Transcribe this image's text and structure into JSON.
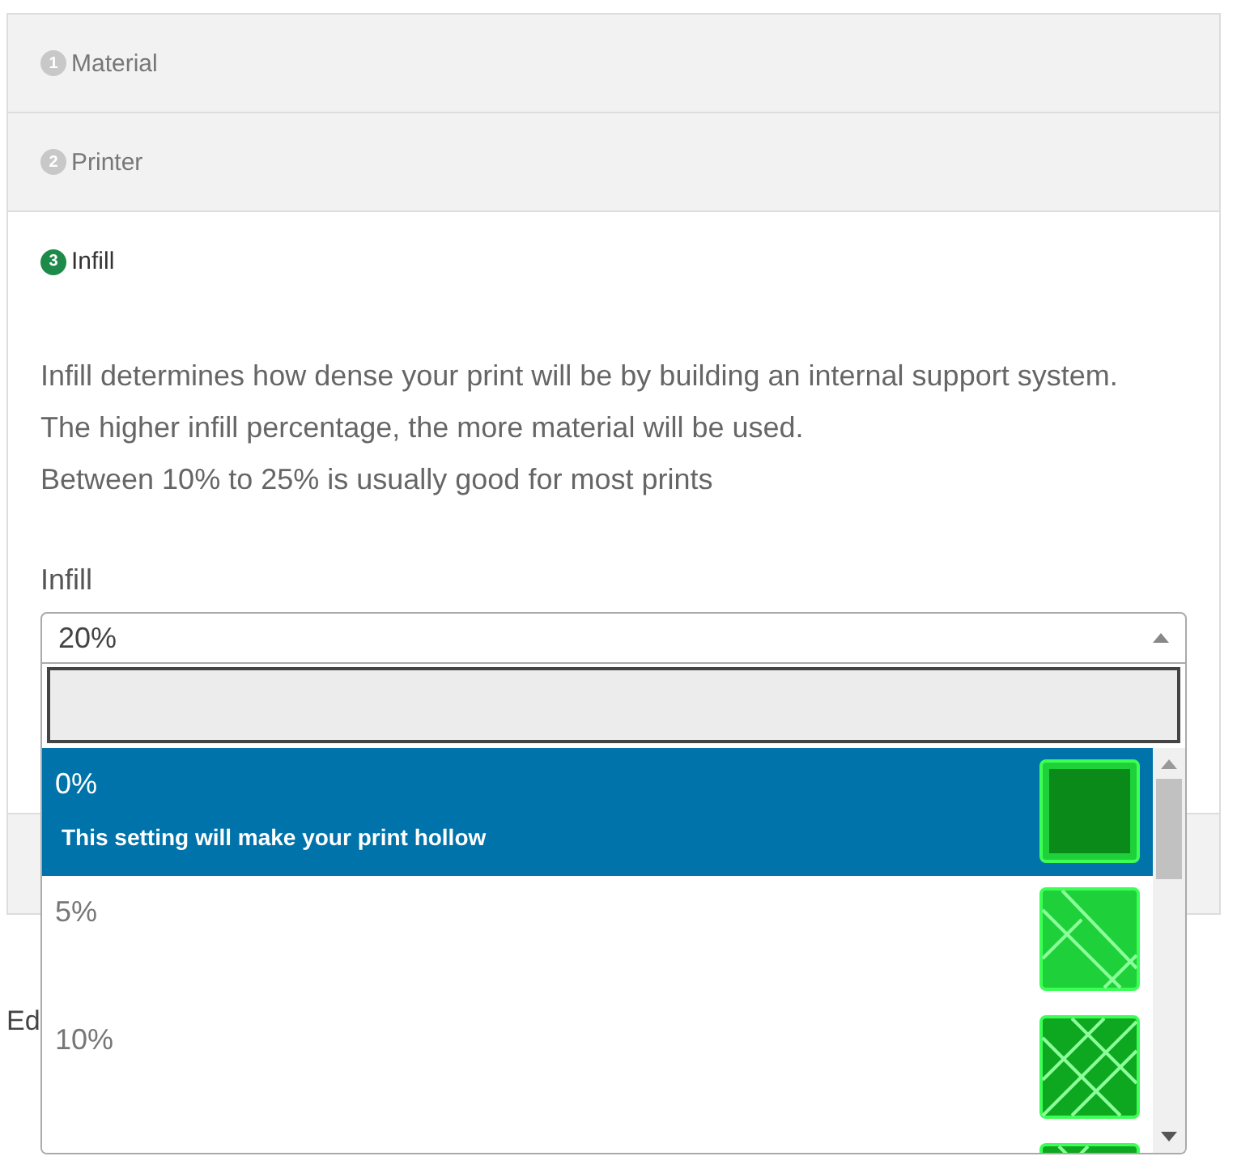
{
  "steps": [
    {
      "number": "1",
      "title": "Material",
      "active": false
    },
    {
      "number": "2",
      "title": "Printer",
      "active": false
    },
    {
      "number": "3",
      "title": "Infill",
      "active": true
    }
  ],
  "description": [
    "Infill determines how dense your print will be by building an internal support system.",
    "The higher infill percentage, the more material will be used.",
    "Between 10% to 25% is usually good for most prints"
  ],
  "field": {
    "label": "Infill",
    "value": "20%",
    "expanded": true
  },
  "options": [
    {
      "label": "0%",
      "note": "This setting will make your print hollow",
      "kind": "hollow",
      "selected": true
    },
    {
      "label": "5%",
      "kind": "sparse",
      "selected": false
    },
    {
      "label": "10%",
      "kind": "grid",
      "selected": false
    },
    {
      "kind": "dense",
      "selected": false
    }
  ],
  "below_text": "Ed"
}
